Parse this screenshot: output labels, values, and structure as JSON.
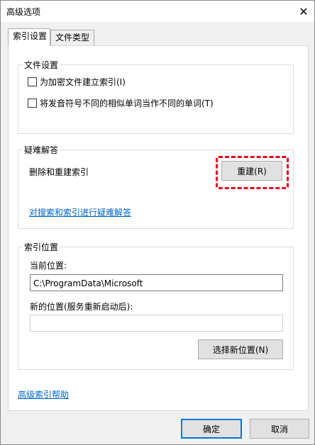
{
  "window": {
    "title": "高级选项",
    "close_glyph": "✕"
  },
  "tabs": [
    {
      "label": "索引设置",
      "active": true
    },
    {
      "label": "文件类型",
      "active": false
    }
  ],
  "file_settings": {
    "legend": "文件设置",
    "checkboxes": [
      {
        "label": "为加密文件建立索引(I)",
        "checked": false
      },
      {
        "label": "将发音符号不同的相似单词当作不同的单词(T)",
        "checked": false
      }
    ]
  },
  "troubleshooting": {
    "legend": "疑难解答",
    "rebuild_label": "删除和重建索引",
    "rebuild_button": "重建(R)",
    "troubleshoot_link": "对搜索和索引进行疑难解答"
  },
  "index_location": {
    "legend": "索引位置",
    "current_label": "当前位置:",
    "current_value": "C:\\ProgramData\\Microsoft",
    "new_label": "新的位置(服务重新启动后):",
    "new_value": "",
    "select_button": "选择新位置(N)"
  },
  "help_link": "高级索引帮助",
  "footer": {
    "ok_button": "确定",
    "cancel_button": "取消"
  },
  "colors": {
    "highlight": "#e6001d",
    "link": "#0066cc",
    "default_button_border": "#0078d7"
  }
}
